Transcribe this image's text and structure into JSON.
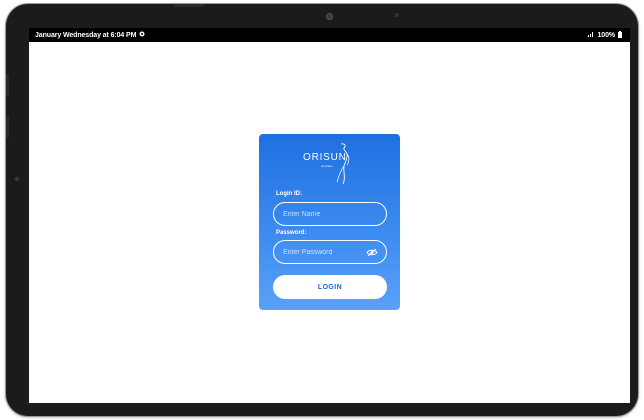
{
  "status_bar": {
    "datetime": "January Wednesday at 6:04 PM",
    "battery": "100%",
    "left_icon": "settings-dot-icon",
    "signal_icon": "signal-icon",
    "battery_icon": "battery-icon"
  },
  "logo": {
    "text": "ORISUN",
    "subtext": "de bravo"
  },
  "form": {
    "login_id_label": "Login ID:",
    "login_id_placeholder": "Enter Name",
    "password_label": "Password:",
    "password_placeholder": "Enter Password",
    "toggle_icon": "eye-off-icon",
    "login_button": "LOGIN"
  },
  "colors": {
    "card_top": "#1f6fe0",
    "card_bottom": "#5aa1f7",
    "button_text": "#2166d8",
    "status_bar_bg": "#000000",
    "screen_bg": "#ffffff"
  }
}
